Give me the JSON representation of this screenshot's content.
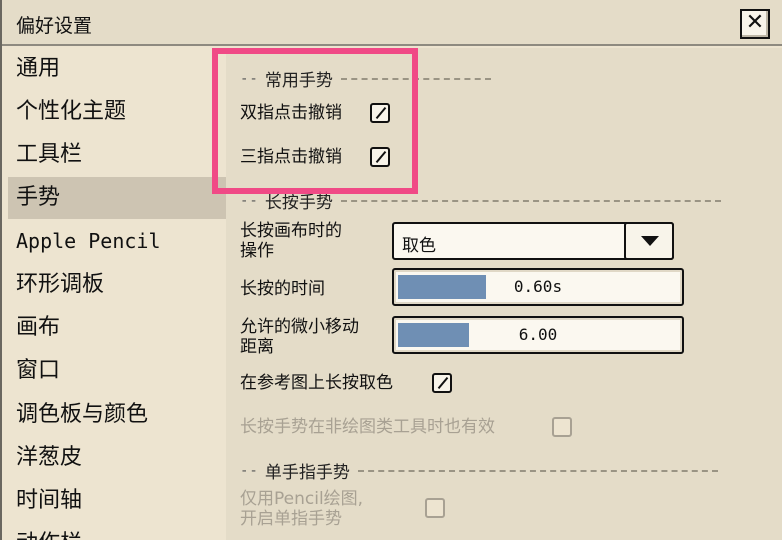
{
  "window": {
    "title": "偏好设置",
    "close_glyph": "✕"
  },
  "sidebar": {
    "items": [
      {
        "label": "通用"
      },
      {
        "label": "个性化主题"
      },
      {
        "label": "工具栏"
      },
      {
        "label": "手势",
        "active": true
      },
      {
        "label": "Apple Pencil"
      },
      {
        "label": "环形调板"
      },
      {
        "label": "画布"
      },
      {
        "label": "窗口"
      },
      {
        "label": "调色板与颜色"
      },
      {
        "label": "洋葱皮"
      },
      {
        "label": "时间轴"
      },
      {
        "label": "动作栏"
      }
    ]
  },
  "content": {
    "common_gestures": {
      "header": "常用手势",
      "two_finger_undo": {
        "label": "双指点击撤销",
        "checked": true
      },
      "three_finger_undo": {
        "label": "三指点击撤销",
        "checked": true
      }
    },
    "long_press": {
      "header": "长按手势",
      "canvas_action": {
        "label_line1": "长按画布时的",
        "label_line2": "操作",
        "value": "取色"
      },
      "duration": {
        "label": "长按的时间",
        "value_text": "0.60s",
        "fill_fraction": 0.31
      },
      "tolerance": {
        "label_line1": "允许的微小移动",
        "label_line2": "距离",
        "value_text": "6.00",
        "fill_fraction": 0.25
      },
      "reference_pick": {
        "label": "在参考图上长按取色",
        "checked": true
      },
      "non_drawing_tools": {
        "label": "长按手势在非绘图类工具时也有效",
        "checked": false,
        "disabled": true
      }
    },
    "single_finger": {
      "header": "单手指手势",
      "pencil_only": {
        "label_line1": "仅用Pencil绘图,",
        "label_line2": "开启单指手势",
        "checked": false,
        "disabled": true
      }
    }
  },
  "colors": {
    "highlight": "#f04a86",
    "slider_fill": "#6f8fb4",
    "active_item": "#cdc4b2"
  }
}
